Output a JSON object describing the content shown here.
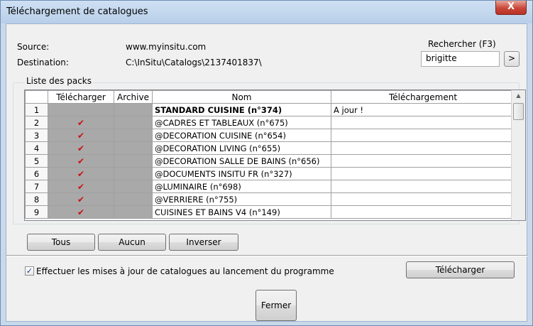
{
  "window": {
    "title": "Téléchargement de catalogues",
    "close_label": "X"
  },
  "source": {
    "label": "Source:",
    "value": "www.myinsitu.com"
  },
  "destination": {
    "label": "Destination:",
    "value": "C:\\InSitu\\Catalogs\\2137401837\\"
  },
  "search": {
    "label": "Rechercher (F3)",
    "value": "brigitte",
    "go_label": ">"
  },
  "packs": {
    "group_label": "Liste des packs",
    "columns": [
      "",
      "Télécharger",
      "Archive",
      "Nom",
      "Téléchargement"
    ],
    "rows": [
      {
        "num": "1",
        "checked": false,
        "name": "STANDARD CUISINE (n°374)",
        "status": "A jour !",
        "bold": true
      },
      {
        "num": "2",
        "checked": true,
        "name": "@CADRES ET TABLEAUX (n°675)",
        "status": ""
      },
      {
        "num": "3",
        "checked": true,
        "name": "@DECORATION CUISINE (n°654)",
        "status": ""
      },
      {
        "num": "4",
        "checked": true,
        "name": "@DECORATION LIVING (n°655)",
        "status": ""
      },
      {
        "num": "5",
        "checked": true,
        "name": "@DECORATION SALLE DE BAINS (n°656)",
        "status": ""
      },
      {
        "num": "6",
        "checked": true,
        "name": "@DOCUMENTS INSITU FR (n°327)",
        "status": ""
      },
      {
        "num": "7",
        "checked": true,
        "name": "@LUMINAIRE (n°698)",
        "status": ""
      },
      {
        "num": "8",
        "checked": true,
        "name": "@VERRIERE (n°755)",
        "status": ""
      },
      {
        "num": "9",
        "checked": true,
        "name": "CUISINES ET BAINS V4 (n°149)",
        "status": ""
      }
    ]
  },
  "buttons": {
    "all": "Tous",
    "none": "Aucun",
    "invert": "Inverser",
    "download": "Télécharger",
    "close": "Fermer"
  },
  "options": {
    "auto_update_label": "Effectuer les mises à jour de catalogues au lancement du programme",
    "auto_update_checked": true
  },
  "icons": {
    "check": "red-check-icon"
  },
  "colors": {
    "check": "#cc1111",
    "disabled_cell": "#a9a9a9",
    "titlebar": "#b8cfe9"
  }
}
